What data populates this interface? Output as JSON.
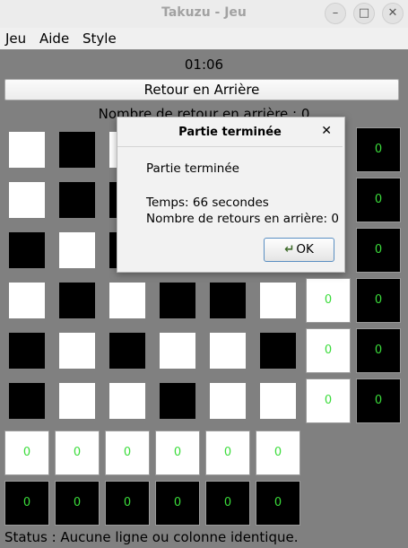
{
  "window": {
    "title": "Takuzu - Jeu"
  },
  "menu": {
    "jeu": "Jeu",
    "aide": "Aide",
    "style": "Style"
  },
  "timer": "01:06",
  "undo_button": "Retour en Arrière",
  "backtrack_count": "Nombre de retour en arrière : 0",
  "status": "Status : Aucune ligne ou colonne identique.",
  "grid": [
    [
      "W",
      "B",
      "W",
      "W",
      "W",
      "W",
      "W",
      "0"
    ],
    [
      "W",
      "B",
      "B",
      "W",
      "W",
      "W",
      "W",
      "0"
    ],
    [
      "B",
      "W",
      "B",
      "W",
      "B",
      "W",
      "W",
      "0"
    ],
    [
      "W",
      "B",
      "W",
      "B",
      "B",
      "W",
      "0",
      "0"
    ],
    [
      "B",
      "W",
      "B",
      "W",
      "W",
      "B",
      "0",
      "0"
    ],
    [
      "B",
      "W",
      "W",
      "B",
      "W",
      "W",
      "0",
      "0"
    ],
    [
      "0",
      "0",
      "0",
      "0",
      "0",
      "0",
      null,
      null
    ],
    [
      "0",
      "0",
      "0",
      "0",
      "0",
      "0",
      null,
      null
    ]
  ],
  "button_colors": {
    "0": [
      "w",
      "w",
      "w",
      "w",
      "w",
      "w",
      "w",
      "b"
    ]
  },
  "dialog": {
    "title": "Partie terminée",
    "message": "Partie terminée",
    "time_line": "Temps: 66 secondes",
    "backtrack_line": "Nombre de retours en arrière: 0",
    "ok_label": "OK"
  }
}
